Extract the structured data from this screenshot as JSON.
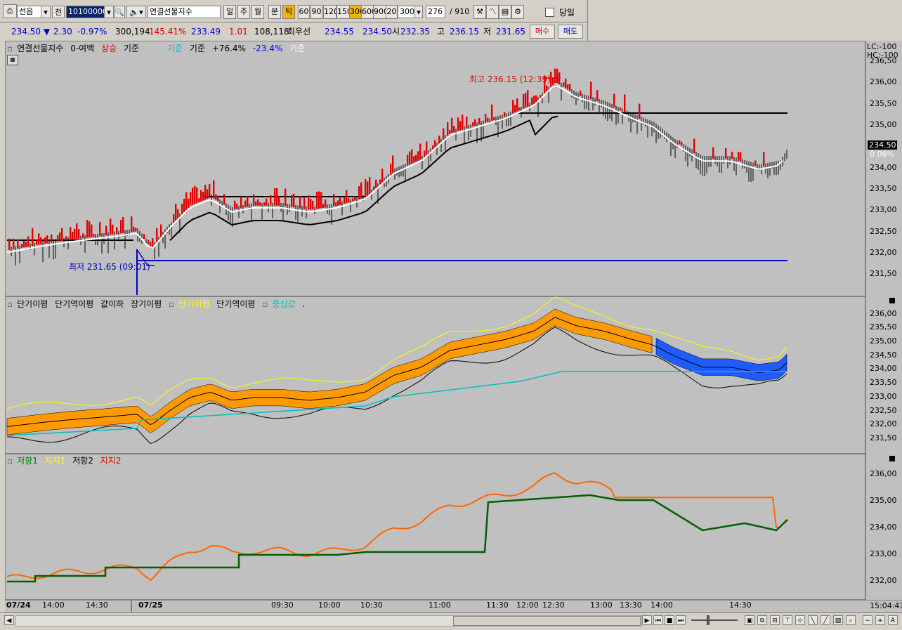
{
  "toolbar": {
    "market_select": "선옵",
    "prev_label": "전",
    "code_value": "10100000",
    "name_value": "연결선물지수",
    "period_buttons": [
      "일",
      "주",
      "월",
      "분",
      "틱"
    ],
    "tick_buttons": [
      "60",
      "90",
      "120",
      "150",
      "300",
      "600",
      "900",
      "20",
      "300"
    ],
    "count_value": "276",
    "count_total": "/ 910",
    "today_label": "당일"
  },
  "quote": {
    "price": "234.50",
    "change": "2.30",
    "change_pct": "-0.97%",
    "volume": "300,194",
    "volume_pct": "145.41%",
    "v1": "233.49",
    "v2": "1.01",
    "v3": "108,118",
    "best_label": "최우선",
    "best_ask": "234.55",
    "best_bid": "234.50",
    "open_label": "시",
    "open": "232.35",
    "high_label": "고",
    "high": "236.15",
    "low_label": "저",
    "low": "231.65",
    "buy_label": "매수",
    "sell_label": "매도"
  },
  "panel1": {
    "legend": [
      "연결선물지수",
      "0-여백",
      "상승",
      "기준",
      "기준",
      "기준",
      "+76.4%",
      "-23.4%",
      "기준"
    ],
    "high_annot": "최고 236.15 (12:39)",
    "low_annot": "최저 231.65 (09:01)",
    "lc": "LC:-100",
    "hc": "HC:-100",
    "price_tag": "234.50",
    "pct_tag": "0.06%",
    "yticks": [
      "236,50",
      "236,00",
      "235,50",
      "235,00",
      "234,50",
      "234,00",
      "233,50",
      "233,00",
      "232,50",
      "232,00",
      "231,50"
    ]
  },
  "panel2": {
    "legend": [
      "단기이평",
      "단기역이평",
      "값이하",
      "장기이평",
      "단기이평",
      "단기역이평",
      "중심값",
      "."
    ],
    "yticks": [
      "236,00",
      "235,50",
      "235,00",
      "234,50",
      "234,00",
      "233,50",
      "233,00",
      "232,50",
      "232,00",
      "231,50"
    ]
  },
  "panel3": {
    "legend": [
      "저항1",
      "지지1",
      "저항2",
      "지지2"
    ],
    "yticks": [
      "236,00",
      "235,00",
      "234,00",
      "233,00",
      "232,00"
    ]
  },
  "xaxis": [
    "07/24",
    "14:00",
    "14:30",
    "07/25",
    "09:30",
    "10:00",
    "10:30",
    "11:00",
    "11:30",
    "12:00",
    "12:30",
    "13:00",
    "13:30",
    "14:00",
    "14:30"
  ],
  "clock": "15:04:43",
  "colors": {
    "up": "#ff0000",
    "down": "#000000",
    "orange": "#ff9900",
    "blue": "#1e5cff",
    "cyan": "#00c0c0",
    "green": "#008000"
  }
}
